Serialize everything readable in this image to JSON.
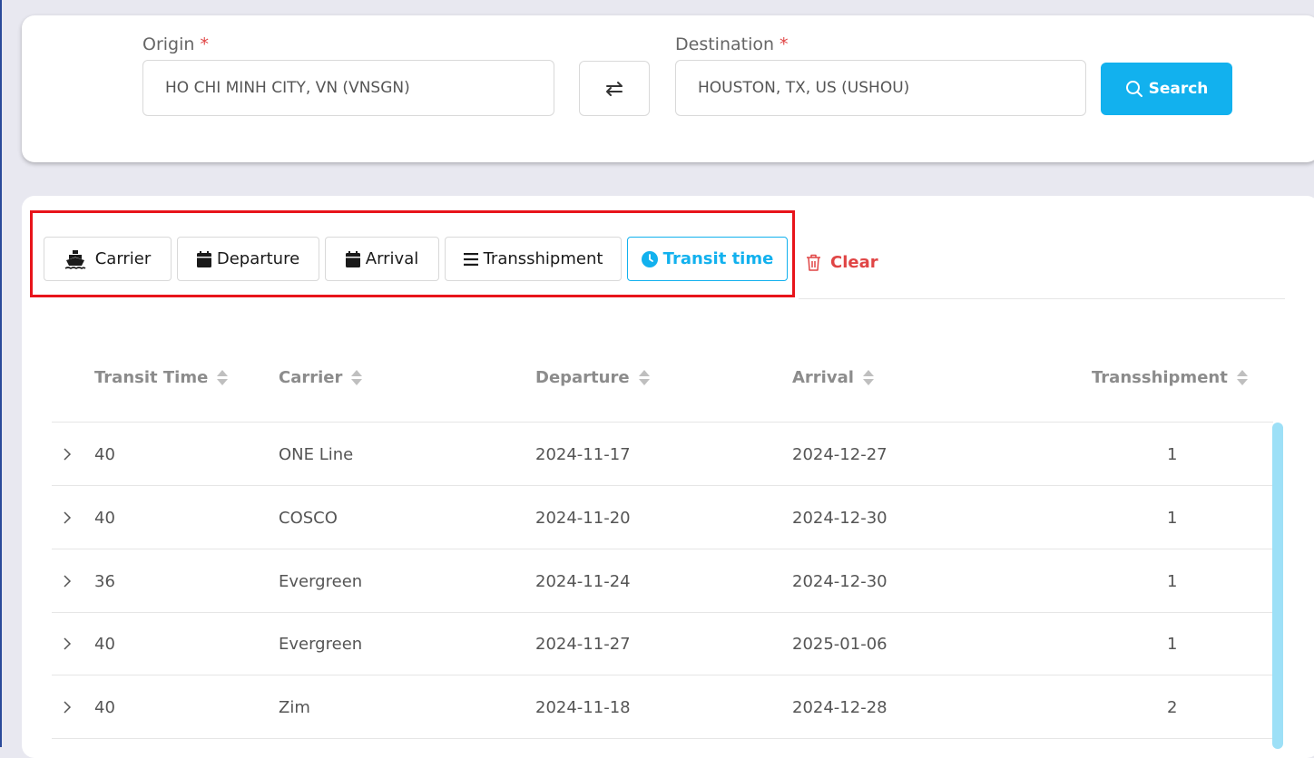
{
  "search": {
    "origin_label": "Origin",
    "origin_required": "*",
    "origin_value": "HO CHI MINH CITY, VN (VNSGN)",
    "destination_label": "Destination",
    "destination_required": "*",
    "destination_value": "HOUSTON, TX, US (USHOU)",
    "search_button": "Search"
  },
  "sort_buttons": {
    "carrier": "Carrier",
    "departure": "Departure",
    "arrival": "Arrival",
    "transshipment": "Transshipment",
    "transit_time": "Transit time",
    "active": "transit_time",
    "clear": "Clear"
  },
  "table": {
    "columns": [
      "Transit Time",
      "Carrier",
      "Departure",
      "Arrival",
      "Transshipment"
    ],
    "rows": [
      {
        "transit_time": "40",
        "carrier": "ONE Line",
        "departure": "2024-11-17",
        "arrival": "2024-12-27",
        "transshipment": "1"
      },
      {
        "transit_time": "40",
        "carrier": "COSCO",
        "departure": "2024-11-20",
        "arrival": "2024-12-30",
        "transshipment": "1"
      },
      {
        "transit_time": "36",
        "carrier": "Evergreen",
        "departure": "2024-11-24",
        "arrival": "2024-12-30",
        "transshipment": "1"
      },
      {
        "transit_time": "40",
        "carrier": "Evergreen",
        "departure": "2024-11-27",
        "arrival": "2025-01-06",
        "transshipment": "1"
      },
      {
        "transit_time": "40",
        "carrier": "Zim",
        "departure": "2024-11-18",
        "arrival": "2024-12-28",
        "transshipment": "2"
      }
    ]
  },
  "colors": {
    "accent": "#12b1ee",
    "danger": "#e04545",
    "highlight": "#e8141b"
  }
}
